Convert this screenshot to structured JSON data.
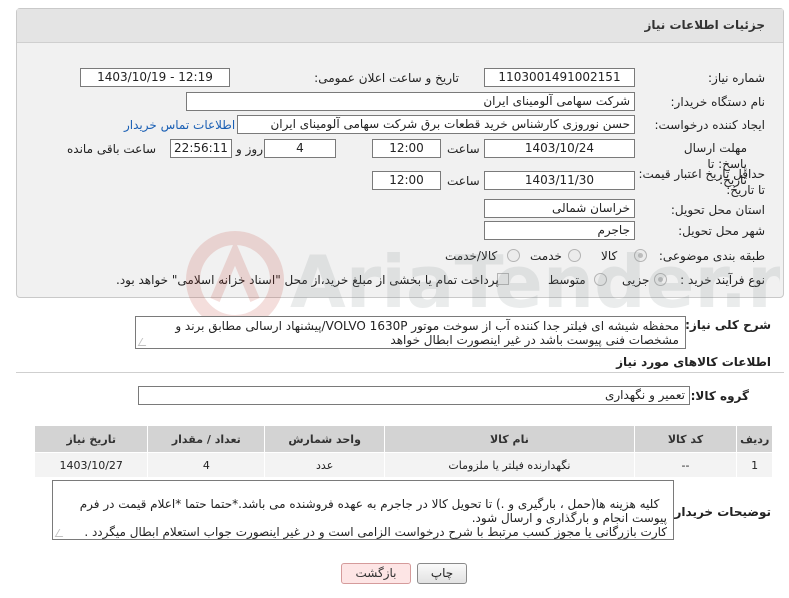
{
  "header": {
    "title": "جزئیات اطلاعات نیاز"
  },
  "form": {
    "need_number_label": "شماره نیاز:",
    "need_number": "1103001491002151",
    "announce_label": "تاریخ و ساعت اعلان عمومی:",
    "announce_value": "1403/10/19 - 12:19",
    "buyer_org_label": "نام دستگاه خریدار:",
    "buyer_org": "شرکت سهامی آلومینای ایران",
    "creator_label": "ایجاد کننده درخواست:",
    "creator": "حسن نوروزی کارشناس خرید قطعات برق شرکت سهامی آلومینای ایران",
    "contact_link": "اطلاعات تماس خریدار",
    "reply_deadline_label": "مهلت ارسال پاسخ: تا تاریخ:",
    "reply_date": "1403/10/24",
    "time_label": "ساعت",
    "reply_time": "12:00",
    "days_value": "4",
    "days_label": "روز و",
    "remaining_time": "22:56:11",
    "remaining_label": "ساعت باقی مانده",
    "price_validity_label": "حداقل تاریخ اعتبار قیمت: تا تاریخ:",
    "validity_date": "1403/11/30",
    "validity_time": "12:00",
    "province_label": "استان محل تحویل:",
    "province": "خراسان شمالی",
    "city_label": "شهر محل تحویل:",
    "city": "جاجرم",
    "category_label": "طبقه بندی موضوعی:",
    "category_options": [
      "کالا",
      "خدمت",
      "کالا/خدمت"
    ],
    "category_selected": "کالا",
    "process_label": "نوع فرآیند خرید :",
    "process_options": [
      "جزیی",
      "متوسط"
    ],
    "process_selected": "جزیی",
    "payment_note": "پرداخت تمام یا بخشی از مبلغ خرید،از محل \"اسناد خزانه اسلامی\" خواهد بود."
  },
  "description": {
    "label": "شرح کلی نیاز:",
    "text": "محفظه شیشه ای فیلتر جدا کننده آب از سوخت موتور VOLVO 1630P/پیشنهاد ارسالی مطابق برند و مشخصات فنی پیوست باشد در غیر اینصورت ابطال خواهد"
  },
  "goods": {
    "section_title": "اطلاعات کالاهای مورد نیاز",
    "group_label": "گروه کالا:",
    "group_value": "تعمیر و نگهداری",
    "columns": [
      "ردیف",
      "کد کالا",
      "نام کالا",
      "واحد شمارش",
      "تعداد / مقدار",
      "تاریخ نیاز"
    ],
    "rows": [
      {
        "row": "1",
        "code": "--",
        "name": "نگهدارنده فیلتر یا ملزومات",
        "unit": "عدد",
        "qty": "4",
        "date": "1403/10/27"
      }
    ]
  },
  "buyer_notes": {
    "label": "توضیحات خریدار:",
    "text": "کلیه هزینه ها(حمل ، بارگیری و .) تا تحویل کالا در جاجرم به عهده فروشنده می باشد.*حتما حتما *اعلام قیمت در فرم پیوست انجام و بارگذاری و ارسال شود.\nکارت بازرگانی یا مجوز کسب مرتبط با شرح درخواست الزامی است و در غیر اینصورت جواب استعلام ابطال میگردد ."
  },
  "buttons": {
    "print": "چاپ",
    "back": "بازگشت"
  },
  "watermark": {
    "text": "AriaTender.neT"
  },
  "colors": {
    "link": "#1a5fb4",
    "back_button_bg": "#fde5e5",
    "table_header": "#d3d3d3"
  }
}
